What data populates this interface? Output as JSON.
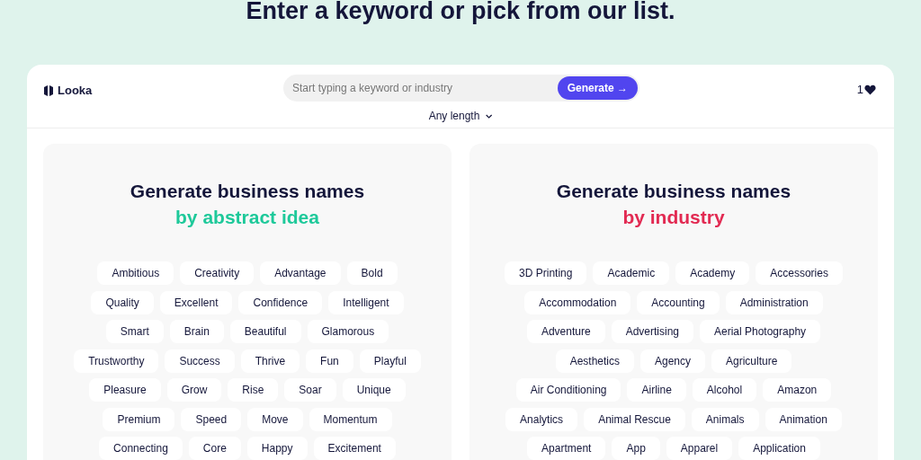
{
  "heading": "Enter a keyword or pick from our list.",
  "header": {
    "brand": "Looka",
    "search": {
      "placeholder": "Start typing a keyword or industry"
    },
    "generate_button": "Generate →",
    "length_dropdown": "Any length",
    "favorites_count": "1"
  },
  "panels": [
    {
      "title": "Generate business names",
      "subtitle": "by abstract idea",
      "color": "#1ec99a",
      "tag_rows": [
        [
          "Ambitious",
          "Creativity",
          "Advantage",
          "Bold"
        ],
        [
          "Quality",
          "Excellent",
          "Confidence",
          "Intelligent"
        ],
        [
          "Smart",
          "Brain",
          "Beautiful",
          "Glamorous"
        ],
        [
          "Trustworthy",
          "Success",
          "Thrive",
          "Fun",
          "Playful"
        ],
        [
          "Pleasure",
          "Grow",
          "Rise",
          "Soar",
          "Unique"
        ],
        [
          "Premium",
          "Speed",
          "Move",
          "Momentum"
        ],
        [
          "Connecting",
          "Core",
          "Happy",
          "Excitement"
        ]
      ]
    },
    {
      "title": "Generate business names",
      "subtitle": "by industry",
      "color": "#e22a52",
      "tag_rows": [
        [
          "3D Printing",
          "Academic",
          "Academy",
          "Accessories"
        ],
        [
          "Accommodation",
          "Accounting",
          "Administration"
        ],
        [
          "Adventure",
          "Advertising",
          "Aerial Photography"
        ],
        [
          "Aesthetics",
          "Agency",
          "Agriculture"
        ],
        [
          "Air Conditioning",
          "Airline",
          "Alcohol",
          "Amazon"
        ],
        [
          "Analytics",
          "Animal Rescue",
          "Animals",
          "Animation"
        ],
        [
          "Apartment",
          "App",
          "Apparel",
          "Application"
        ]
      ]
    }
  ]
}
